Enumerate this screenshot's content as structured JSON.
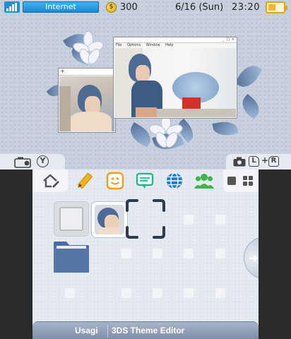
{
  "status": {
    "connection": "Internet",
    "coins": "300",
    "date": "6/16 (Sun)",
    "time": "23:20",
    "coin_symbol": "$"
  },
  "top_window": {
    "menu": [
      "File",
      "Options",
      "Window",
      "Help"
    ]
  },
  "small_window": {
    "add_symbol": "+"
  },
  "camera_tab_left": {
    "y_label": "Y"
  },
  "camera_tab_right": {
    "l_label": "L",
    "plus": "+",
    "r_label": "R"
  },
  "toolbar": {
    "icons": [
      "home-settings-icon",
      "pencil-icon",
      "smiley-icon",
      "chat-icon",
      "globe-icon",
      "people-icon"
    ],
    "colors": {
      "pencil": "#f2b21b",
      "smiley": "#f49b1a",
      "chat": "#20b98a",
      "globe": "#1b7fd6",
      "people": "#3cb54a"
    }
  },
  "bottom_bar": {
    "user": "Usagi",
    "title": "3DS Theme Editor"
  },
  "colors": {
    "top_bg": "#c9d0dd",
    "bottom_bg": "#e6eaf1",
    "folder": "#4d6d9c",
    "accent": "#1f8fd8"
  }
}
